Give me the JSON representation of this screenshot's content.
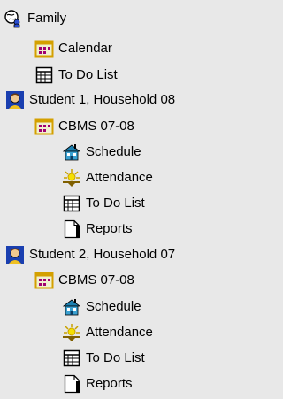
{
  "tree": {
    "family": {
      "label": "Family",
      "icon": "family-globe-icon"
    },
    "family_children": [
      {
        "label": "Calendar",
        "icon": "calendar-icon"
      },
      {
        "label": "To Do List",
        "icon": "todo-list-icon"
      }
    ],
    "students": [
      {
        "label": "Student 1, Household 08",
        "icon": "student-icon",
        "program": {
          "label": "CBMS 07-08",
          "icon": "calendar-icon"
        },
        "items": [
          {
            "label": "Schedule",
            "icon": "schedule-icon"
          },
          {
            "label": "Attendance",
            "icon": "attendance-icon"
          },
          {
            "label": "To Do List",
            "icon": "todo-list-icon"
          },
          {
            "label": "Reports",
            "icon": "reports-icon"
          }
        ]
      },
      {
        "label": "Student 2, Household 07",
        "icon": "student-icon",
        "program": {
          "label": "CBMS 07-08",
          "icon": "calendar-icon"
        },
        "items": [
          {
            "label": "Schedule",
            "icon": "schedule-icon"
          },
          {
            "label": "Attendance",
            "icon": "attendance-icon"
          },
          {
            "label": "To Do List",
            "icon": "todo-list-icon"
          },
          {
            "label": "Reports",
            "icon": "reports-icon"
          }
        ]
      }
    ]
  },
  "colors": {
    "background": "#e8e8e8",
    "calendar_border": "#d4a000",
    "calendar_fill": "#f0f0d0",
    "calendar_accent": "#a00070"
  }
}
